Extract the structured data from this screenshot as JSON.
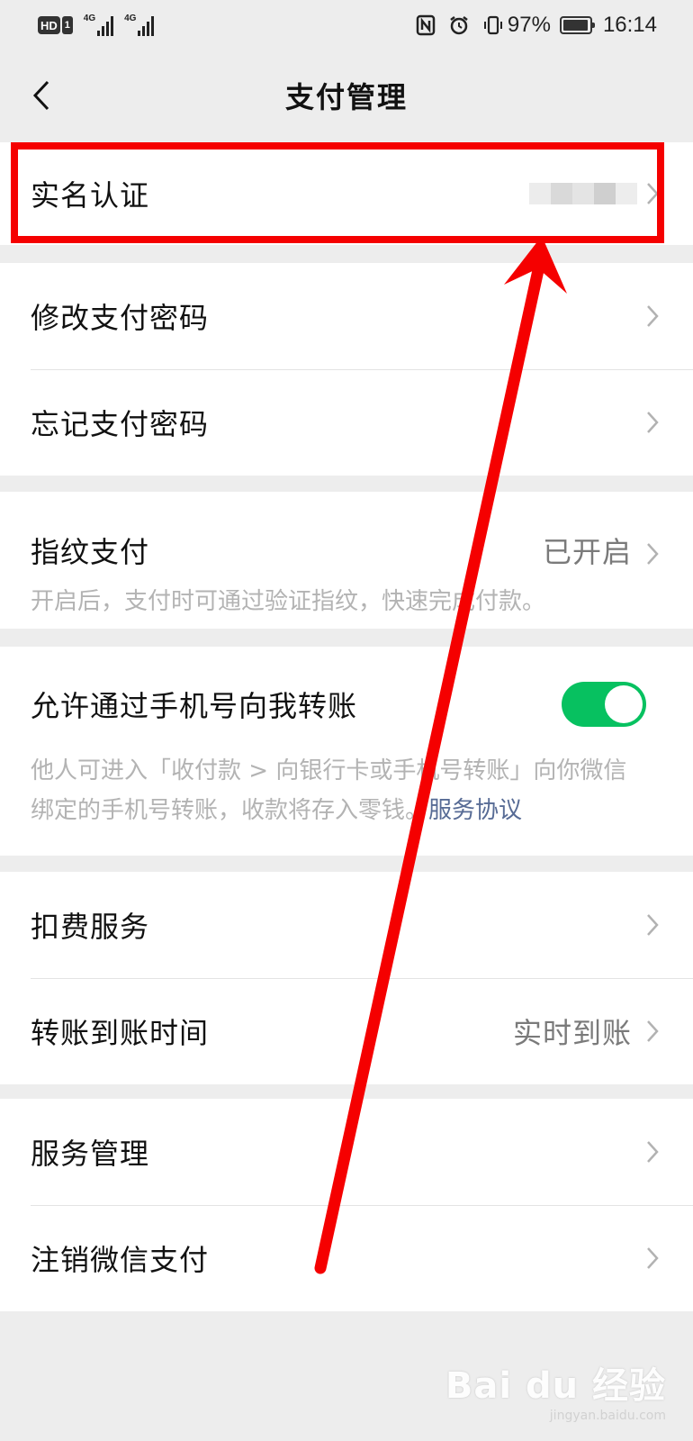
{
  "status_bar": {
    "hd_label": "HD",
    "sim_label": "1",
    "net1": "4G",
    "net2": "4G",
    "battery_percent": "97%",
    "battery_level": 0.97,
    "time": "16:14",
    "icons": [
      "nfc-icon",
      "alarm-icon",
      "vibrate-icon",
      "battery-icon"
    ]
  },
  "header": {
    "title": "支付管理",
    "back_icon": "chevron-left-icon"
  },
  "rows": {
    "real_name": {
      "label": "实名认证"
    },
    "change_password": {
      "label": "修改支付密码"
    },
    "forgot_password": {
      "label": "忘记支付密码"
    },
    "fingerprint": {
      "label": "指纹支付",
      "value": "已开启",
      "description": "开启后，支付时可通过验证指纹，快速完成付款。"
    },
    "phone_transfer": {
      "label": "允许通过手机号向我转账",
      "toggle_on": true,
      "description": "他人可进入「收付款 > 向银行卡或手机号转账」向你微信绑定的手机号转账，收款将存入零钱。",
      "link": "服务协议"
    },
    "deduction": {
      "label": "扣费服务"
    },
    "transfer_time": {
      "label": "转账到账时间",
      "value": "实时到账"
    },
    "service_manage": {
      "label": "服务管理"
    },
    "cancel_pay": {
      "label": "注销微信支付"
    }
  },
  "watermark": {
    "logo": "Bai du 经验",
    "url": "jingyan.baidu.com"
  },
  "colors": {
    "background": "#ededed",
    "accent_green": "#07c160",
    "link_blue": "#576b95",
    "annotation_red": "#f50000"
  }
}
